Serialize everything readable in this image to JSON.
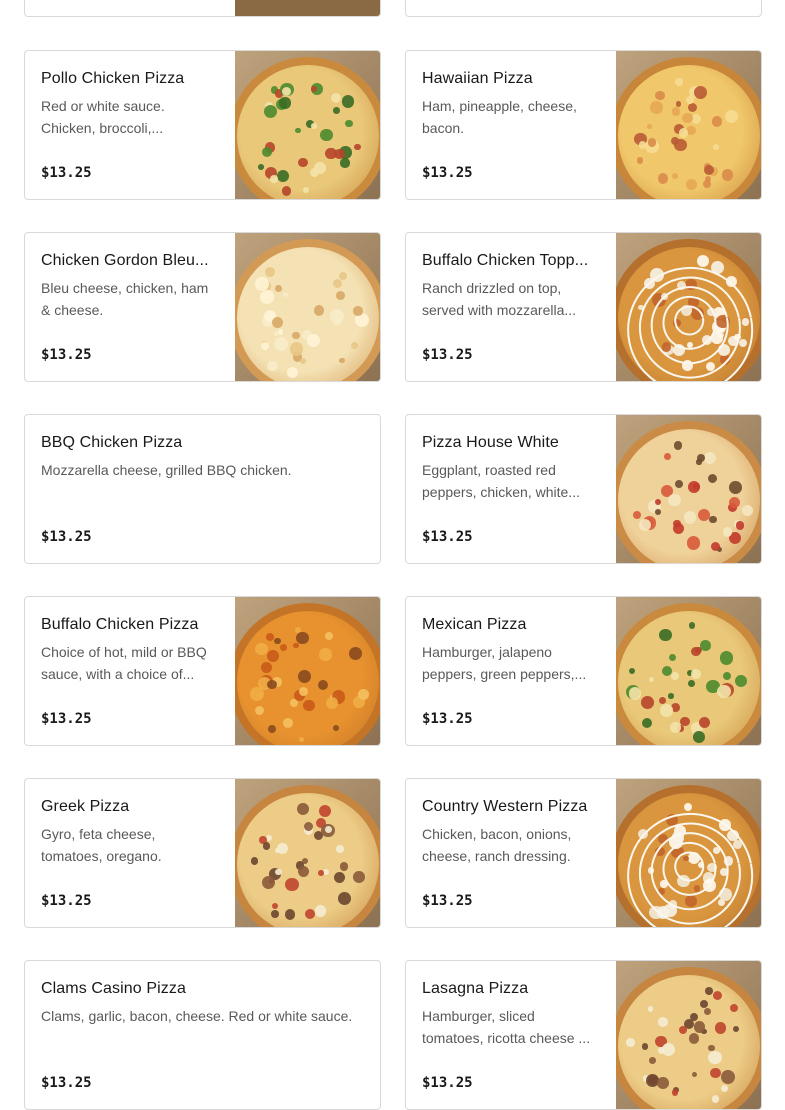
{
  "colors": {
    "card_border": "#d9d9d9",
    "title": "#191919",
    "description": "#595959",
    "price": "#191919"
  },
  "menu": {
    "items": [
      {
        "name": "Pollo Chicken Pizza",
        "description": "Red or white sauce. Chicken, broccoli,...",
        "price": "$13.25",
        "image": "pizza-photo-chicken-broccoli",
        "style": "veggie"
      },
      {
        "name": "Hawaiian Pizza",
        "description": "Ham, pineapple, cheese, bacon.",
        "price": "$13.25",
        "image": "pizza-photo-hawaiian",
        "style": "cheese"
      },
      {
        "name": "Chicken Gordon Bleu...",
        "description": "Bleu cheese, chicken, ham & cheese.",
        "price": "$13.25",
        "image": "pizza-photo-gordon-bleu",
        "style": "white"
      },
      {
        "name": "Buffalo Chicken Topp...",
        "description": "Ranch drizzled on top, served with mozzarella...",
        "price": "$13.25",
        "image": "pizza-photo-buffalo-ranch",
        "style": "ranch"
      },
      {
        "name": "BBQ Chicken Pizza",
        "description": "Mozzarella cheese, grilled BBQ chicken.",
        "price": "$13.25",
        "image": null,
        "style": null
      },
      {
        "name": "Pizza House White",
        "description": "Eggplant, roasted red peppers, chicken, white...",
        "price": "$13.25",
        "image": "pizza-photo-house-white",
        "style": "peppers"
      },
      {
        "name": "Buffalo Chicken Pizza",
        "description": "Choice of hot, mild or BBQ sauce, with a choice of...",
        "price": "$13.25",
        "image": "pizza-photo-buffalo-chicken",
        "style": "orange"
      },
      {
        "name": "Mexican Pizza",
        "description": "Hamburger, jalapeno peppers, green peppers,...",
        "price": "$13.25",
        "image": "pizza-photo-mexican",
        "style": "veggie"
      },
      {
        "name": "Greek Pizza",
        "description": "Gyro, feta cheese, tomatoes, oregano.",
        "price": "$13.25",
        "image": "pizza-photo-greek",
        "style": "meat"
      },
      {
        "name": "Country Western Pizza",
        "description": "Chicken, bacon, onions, cheese, ranch dressing.",
        "price": "$13.25",
        "image": "pizza-photo-country-western",
        "style": "ranch"
      },
      {
        "name": "Clams Casino Pizza",
        "description": "Clams, garlic, bacon, cheese. Red or white sauce.",
        "price": "$13.25",
        "image": null,
        "style": null
      },
      {
        "name": "Lasagna Pizza",
        "description": "Hamburger, sliced tomatoes, ricotta cheese ...",
        "price": "$13.25",
        "image": "pizza-photo-lasagna",
        "style": "meat"
      }
    ]
  }
}
